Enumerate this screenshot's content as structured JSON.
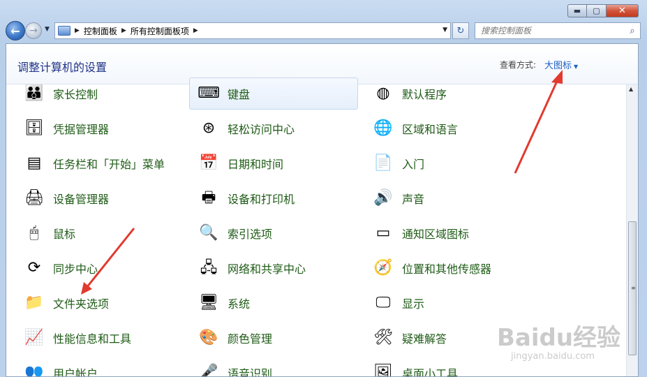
{
  "window": {
    "buttons": {
      "minimize": "▬",
      "maximize": "▢",
      "close": "✕"
    }
  },
  "nav": {
    "breadcrumbs": [
      "控制面板",
      "所有控制面板项"
    ],
    "search_placeholder": "搜索控制面板"
  },
  "header": {
    "title": "调整计算机的设置",
    "view_label": "查看方式:",
    "view_value": "大图标"
  },
  "items": [
    {
      "label": "家长控制",
      "icon": "parental-controls-icon",
      "glyph": "👪",
      "highlighted": false
    },
    {
      "label": "键盘",
      "icon": "keyboard-icon",
      "glyph": "⌨",
      "highlighted": true
    },
    {
      "label": "默认程序",
      "icon": "default-programs-icon",
      "glyph": "◍",
      "highlighted": false
    },
    {
      "label": "凭据管理器",
      "icon": "credential-manager-icon",
      "glyph": "🗄",
      "highlighted": false
    },
    {
      "label": "轻松访问中心",
      "icon": "ease-of-access-icon",
      "glyph": "⊛",
      "highlighted": false
    },
    {
      "label": "区域和语言",
      "icon": "region-language-icon",
      "glyph": "🌐",
      "highlighted": false
    },
    {
      "label": "任务栏和「开始」菜单",
      "icon": "taskbar-start-menu-icon",
      "glyph": "▤",
      "highlighted": false
    },
    {
      "label": "日期和时间",
      "icon": "date-time-icon",
      "glyph": "📅",
      "highlighted": false
    },
    {
      "label": "入门",
      "icon": "getting-started-icon",
      "glyph": "📄",
      "highlighted": false
    },
    {
      "label": "设备管理器",
      "icon": "device-manager-icon",
      "glyph": "🖨",
      "highlighted": false
    },
    {
      "label": "设备和打印机",
      "icon": "devices-printers-icon",
      "glyph": "🖶",
      "highlighted": false
    },
    {
      "label": "声音",
      "icon": "sound-icon",
      "glyph": "🔊",
      "highlighted": false
    },
    {
      "label": "鼠标",
      "icon": "mouse-icon",
      "glyph": "🖱",
      "highlighted": false
    },
    {
      "label": "索引选项",
      "icon": "indexing-options-icon",
      "glyph": "🔍",
      "highlighted": false
    },
    {
      "label": "通知区域图标",
      "icon": "notification-area-icon",
      "glyph": "▭",
      "highlighted": false
    },
    {
      "label": "同步中心",
      "icon": "sync-center-icon",
      "glyph": "⟳",
      "highlighted": false
    },
    {
      "label": "网络和共享中心",
      "icon": "network-sharing-icon",
      "glyph": "🖧",
      "highlighted": false
    },
    {
      "label": "位置和其他传感器",
      "icon": "location-sensors-icon",
      "glyph": "🧭",
      "highlighted": false
    },
    {
      "label": "文件夹选项",
      "icon": "folder-options-icon",
      "glyph": "📁",
      "highlighted": false
    },
    {
      "label": "系统",
      "icon": "system-icon",
      "glyph": "🖥",
      "highlighted": false
    },
    {
      "label": "显示",
      "icon": "display-icon",
      "glyph": "🖵",
      "highlighted": false
    },
    {
      "label": "性能信息和工具",
      "icon": "performance-tools-icon",
      "glyph": "📈",
      "highlighted": false
    },
    {
      "label": "颜色管理",
      "icon": "color-management-icon",
      "glyph": "🎨",
      "highlighted": false
    },
    {
      "label": "疑难解答",
      "icon": "troubleshooting-icon",
      "glyph": "🛠",
      "highlighted": false
    },
    {
      "label": "用户帐户",
      "icon": "user-accounts-icon",
      "glyph": "👥",
      "highlighted": false
    },
    {
      "label": "语音识别",
      "icon": "speech-recognition-icon",
      "glyph": "🎤",
      "highlighted": false
    },
    {
      "label": "桌面小工具",
      "icon": "desktop-gadgets-icon",
      "glyph": "🖼",
      "highlighted": false
    }
  ],
  "watermark": {
    "main": "Baidu经验",
    "sub": "jingyan.baidu.com"
  },
  "colors": {
    "link_green": "#1e5b16",
    "title_blue": "#1e3287",
    "view_blue": "#1f5fc3",
    "arrow_red": "#e23a2e"
  }
}
